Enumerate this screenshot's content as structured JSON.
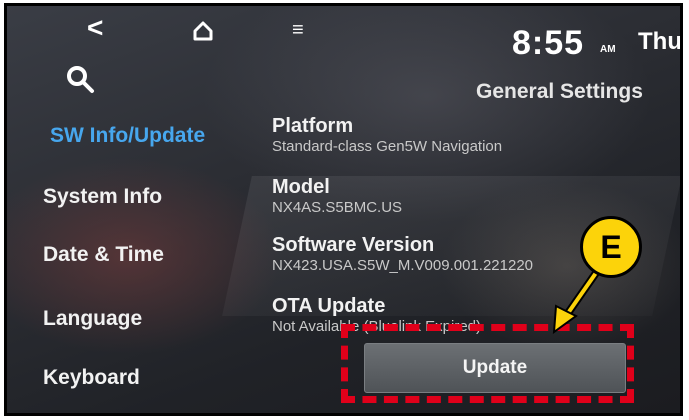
{
  "status": {
    "time": "8:55",
    "ampm": "AM",
    "day": "Thu,"
  },
  "header": {
    "title": "General Settings",
    "icons": [
      "back-icon",
      "home-icon",
      "menu-icon",
      "search-icon"
    ]
  },
  "sidebar": {
    "items": [
      {
        "label": "SW Info/Update",
        "active": true
      },
      {
        "label": "System Info",
        "active": false
      },
      {
        "label": "Date & Time",
        "active": false
      },
      {
        "label": "Language",
        "active": false
      },
      {
        "label": "Keyboard",
        "active": false
      }
    ]
  },
  "main": {
    "platform": {
      "title": "Platform",
      "value": "Standard-class Gen5W Navigation"
    },
    "model": {
      "title": "Model",
      "value": "NX4AS.S5BMC.US"
    },
    "software": {
      "title": "Software Version",
      "value": "NX423.USA.S5W_M.V009.001.221220"
    },
    "ota": {
      "title": "OTA Update",
      "value": "Not Available (Bluelink Expired)"
    },
    "update_label": "Update"
  },
  "annotation": {
    "callout_letter": "E",
    "callout_color": "#fcd30a",
    "highlight_color": "#e0001a"
  },
  "colors": {
    "active_item": "#47a7ee"
  }
}
